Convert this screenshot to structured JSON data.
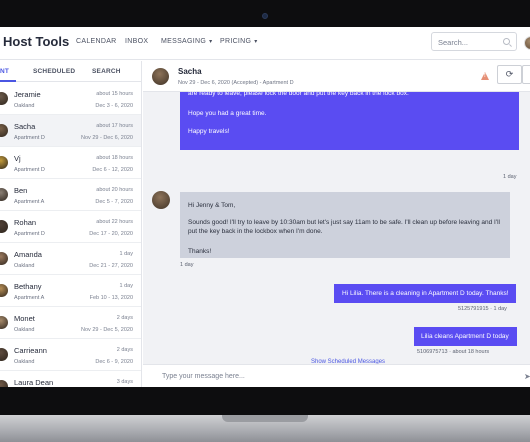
{
  "app": {
    "logo": "Host Tools"
  },
  "nav": [
    {
      "label": "CALENDAR",
      "caret": ""
    },
    {
      "label": "INBOX",
      "caret": ""
    },
    {
      "label": "MESSAGING",
      "caret": "▾"
    },
    {
      "label": "PRICING",
      "caret": "▾"
    }
  ],
  "search": {
    "placeholder": "Search..."
  },
  "sidebar": {
    "tabs": [
      {
        "label": "NT",
        "active": true
      },
      {
        "label": "SCHEDULED",
        "active": false
      },
      {
        "label": "SEARCH",
        "active": false
      }
    ],
    "conversations": [
      {
        "name": "Jeramie",
        "property": "Oakland",
        "time": "about 15 hours",
        "dates": "Dec 3 - 6, 2020",
        "avatar": "#6b5a4a"
      },
      {
        "name": "Sacha",
        "property": "Apartment D",
        "time": "about 17 hours",
        "dates": "Nov 29 - Dec 6, 2020",
        "avatar": "#7a6149"
      },
      {
        "name": "Vj",
        "property": "Apartment D",
        "time": "about 18 hours",
        "dates": "Dec 6 - 12, 2020",
        "avatar": "#c19a3a"
      },
      {
        "name": "Ben",
        "property": "Apartment A",
        "time": "about 20 hours",
        "dates": "Dec 5 - 7, 2020",
        "avatar": "#8a7f74"
      },
      {
        "name": "Rohan",
        "property": "Apartment D",
        "time": "about 22 hours",
        "dates": "Dec 17 - 20, 2020",
        "avatar": "#4f4036"
      },
      {
        "name": "Amanda",
        "property": "Oakland",
        "time": "1 day",
        "dates": "Dec 21 - 27, 2020",
        "avatar": "#9b7a5e"
      },
      {
        "name": "Bethany",
        "property": "Apartment A",
        "time": "1 day",
        "dates": "Feb 10 - 13, 2020",
        "avatar": "#b58d55"
      },
      {
        "name": "Monet",
        "property": "Oakland",
        "time": "2 days",
        "dates": "Nov 29 - Dec 5, 2020",
        "avatar": "#a68a6a"
      },
      {
        "name": "Carrieann",
        "property": "Oakland",
        "time": "2 days",
        "dates": "Dec 6 - 9, 2020",
        "avatar": "#5d4b3d"
      },
      {
        "name": "Laura Dean",
        "property": "",
        "time": "3 days",
        "dates": "",
        "avatar": "#6e5846"
      }
    ]
  },
  "chat": {
    "name": "Sacha",
    "subtitle": "Nov 29 - Dec 6, 2020 (Accepted) - Apartment D",
    "messages": {
      "m1_line1": "are ready to leave, please lock the door and put the key back in the lock box.",
      "m1_line2": "Hope you had a great time.",
      "m1_line3": "Happy travels!",
      "m1_meta": "1 day",
      "m2_line1": "Hi Jenny & Tom,",
      "m2_line2": "Sounds good! I'll try to leave by 10:30am but let's just say 11am to be safe. I'll clean up before leaving and I'll put the key back in the lockbox when I'm done.",
      "m2_line3": "Thanks!",
      "m2_meta": "1 day",
      "m3_text": "Hi Lilia. There is a cleaning in Apartment D today. Thanks!",
      "m3_meta": "5125791915 · 1 day",
      "m4_text": "Lilia cleans Apartment D today",
      "m4_meta": "5106975713 · about 18 hours"
    },
    "show_scheduled": "Show Scheduled Messages",
    "composer_placeholder": "Type your message here..."
  },
  "icons": {
    "refresh": "refresh-icon",
    "warning": "warning-icon",
    "send": "send-icon",
    "search": "search-icon"
  },
  "colors": {
    "accent": "#4a56e2",
    "outgoing_bubble": "#5a4cf2",
    "incoming_bubble": "#cdd1dc",
    "warning": "#e58f75"
  }
}
